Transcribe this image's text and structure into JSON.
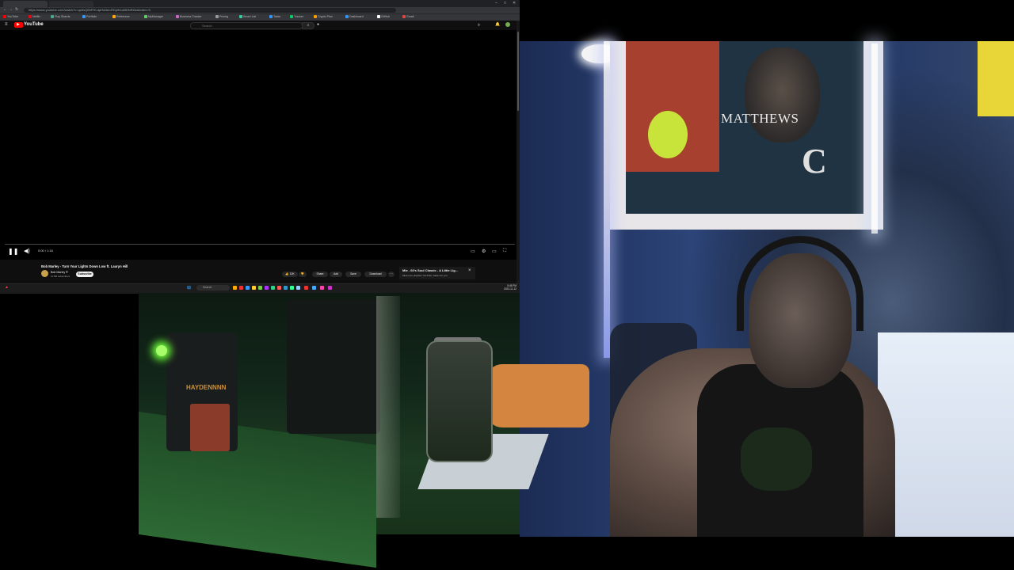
{
  "browser": {
    "tabs": [
      "",
      "",
      ""
    ],
    "url": "https://www.youtube.com/watch?v=qu5sQ6hPIH-dpH&list=RDp94uk5DNRZw&index=5",
    "bookmarks": [
      "YouTube",
      "Netflix",
      "Play Shards",
      "Portfolio",
      "Reference",
      "MyManager",
      "Business Tracker",
      "Pricing",
      "Smart List",
      "Tasks",
      "Tracker",
      "Crypto Plan",
      "Dashboard",
      "GitHub",
      "Gmail"
    ]
  },
  "youtube": {
    "logo_text": "YouTube",
    "search_placeholder": "Search",
    "player": {
      "time": "0:00 / 1:16"
    },
    "video_title": "Bob Marley - Turn Your Lights Down Low ft. Lauryn Hill",
    "channel_name": "Bob Marley ®",
    "channel_subs": "11.5M subscribers",
    "subscribe_label": "Subscribe",
    "actions": {
      "likes": "12K",
      "share": "Share",
      "add": "Add",
      "save": "Save",
      "download": "Download",
      "more": "⋯"
    },
    "mix_title": "Mix - 60's Soul Classic - A Little Lig...",
    "mix_sub": "Mixes are playlists YouTube makes for you"
  },
  "taskbar": {
    "search_label": "Search",
    "clock_time": "5:45 PM",
    "clock_date": "2023-11-12"
  },
  "webcam": {
    "poster_name": "MATTHEWS",
    "poster_letter": "C"
  },
  "deskcam": {
    "can_label": "HAYDENNNN"
  },
  "colors": {
    "youtube_red": "#ff0000",
    "led": "#ffffff",
    "desk_light": "#6cff3a"
  }
}
